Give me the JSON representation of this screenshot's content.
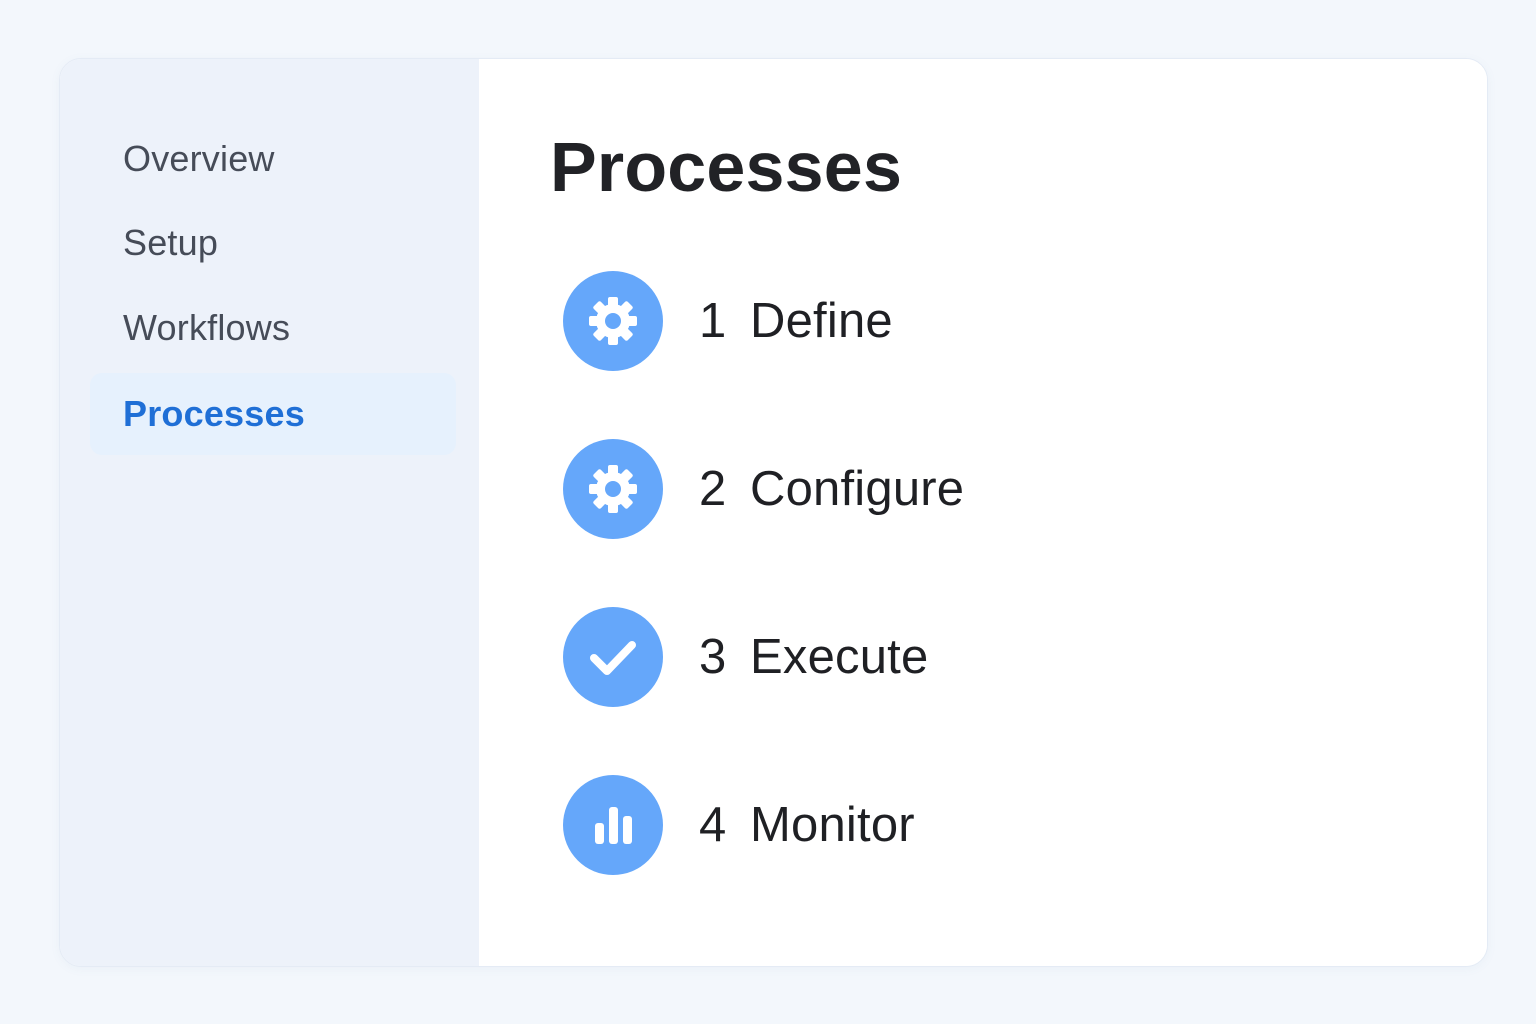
{
  "sidebar": {
    "items": [
      {
        "label": "Overview",
        "active": false
      },
      {
        "label": "Setup",
        "active": false
      },
      {
        "label": "Workflows",
        "active": false
      },
      {
        "label": "Processes",
        "active": true
      }
    ]
  },
  "main": {
    "title": "Processes",
    "steps": [
      {
        "number": "1",
        "label": "Define",
        "icon": "gear-icon"
      },
      {
        "number": "2",
        "label": "Configure",
        "icon": "gear-icon"
      },
      {
        "number": "3",
        "label": "Execute",
        "icon": "checkmark-icon"
      },
      {
        "number": "4",
        "label": "Monitor",
        "icon": "bar-chart-icon"
      }
    ]
  },
  "colors": {
    "page_background": "#f3f7fc",
    "sidebar_background": "#edf2fa",
    "active_item_background": "#e6f1fd",
    "active_item_text": "#1f6fd6",
    "icon_circle": "#65a7fa",
    "text_primary": "#1f2024",
    "text_nav": "#464c58"
  }
}
